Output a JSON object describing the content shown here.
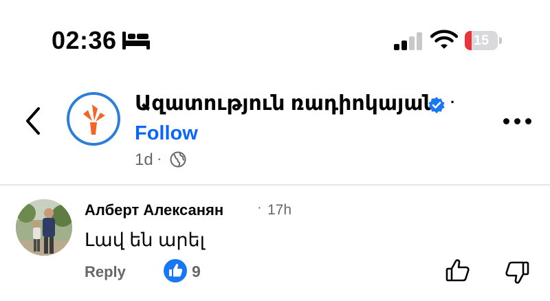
{
  "status_bar": {
    "time": "02:36",
    "battery_level": "15",
    "battery_fraction": 0.15,
    "icons": [
      "bed-icon",
      "signal-icon",
      "wifi-icon",
      "battery-icon"
    ]
  },
  "post_header": {
    "page_name": "Ազատություն ռադիոկայան",
    "verified": true,
    "separator": "·",
    "follow_label": "Follow",
    "post_age": "1d",
    "meta_separator": "·",
    "audience_icon": "globe-icon",
    "back_icon": "chevron-left-icon",
    "more_icon": "more-horizontal-icon"
  },
  "comment": {
    "author": "Алберт Алексанян",
    "separator": "·",
    "time": "17h",
    "text": "Լավ են արել",
    "reply_label": "Reply",
    "reaction_icon": "like-icon",
    "reaction_count": "9"
  },
  "colors": {
    "accent": "#0866ff",
    "verified": "#1877f2",
    "logo_orange": "#f26522",
    "logo_ring": "#2b7fd9",
    "battery_low": "#e8343b",
    "secondary_text": "#65676b"
  }
}
